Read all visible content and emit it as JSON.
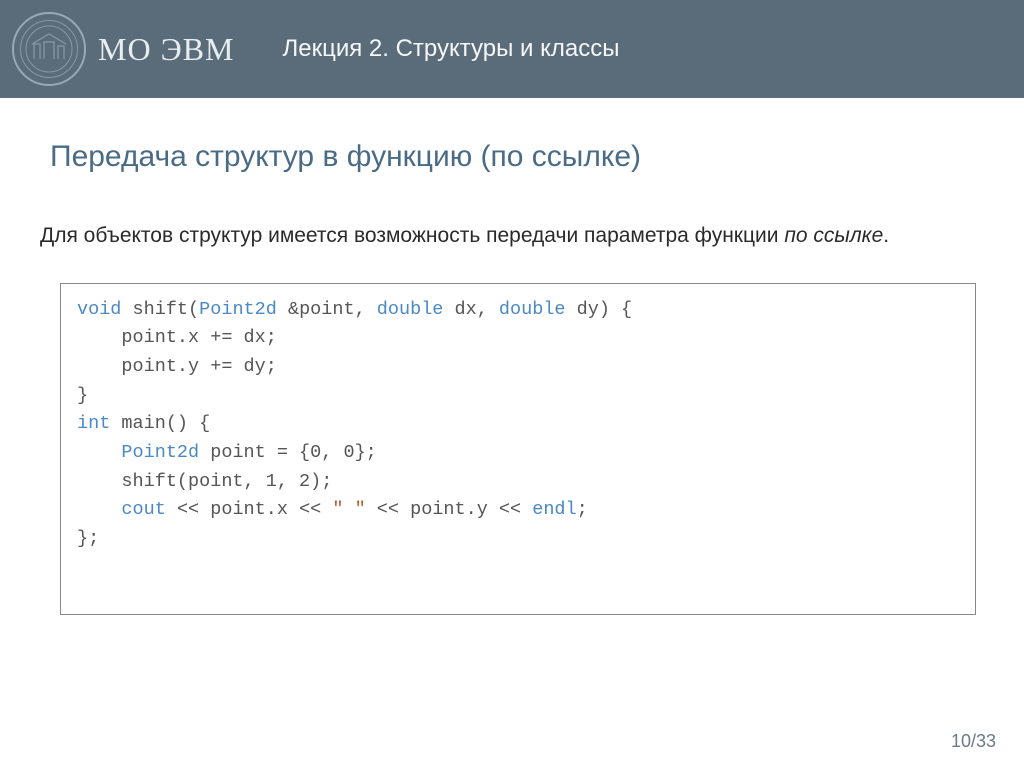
{
  "header": {
    "brand": "МО ЭВМ",
    "lecture": "Лекция 2.  Структуры и классы"
  },
  "section_title": "Передача структур в функцию (по ссылке)",
  "body_prefix": "Для объектов структур имеется возможность передачи параметра функции ",
  "body_italic": "по ссылке",
  "body_suffix": ".",
  "code": {
    "l1_void": "void",
    "l1_shift": " shift(",
    "l1_point2d": "Point2d",
    "l1_amp": " &point, ",
    "l1_double1": "double",
    "l1_dx": " dx, ",
    "l1_double2": "double",
    "l1_dy": " dy) {",
    "l2": "    point.x += dx;",
    "l3": "    point.y += dy;",
    "l4": "}",
    "l5": "",
    "l6_int": "int",
    "l6_main": " main() {",
    "l7_pre": "    ",
    "l7_point2d": "Point2d",
    "l7_rest": " point = {0, 0};",
    "l8": "    shift(point, 1, 2);",
    "l9_pre": "    ",
    "l9_cout": "cout",
    "l9_a": " << point.x << ",
    "l9_str": "\" \"",
    "l9_b": " << point.y << ",
    "l9_endl": "endl",
    "l9_semi": ";",
    "l10": "};"
  },
  "footer": "10/33"
}
